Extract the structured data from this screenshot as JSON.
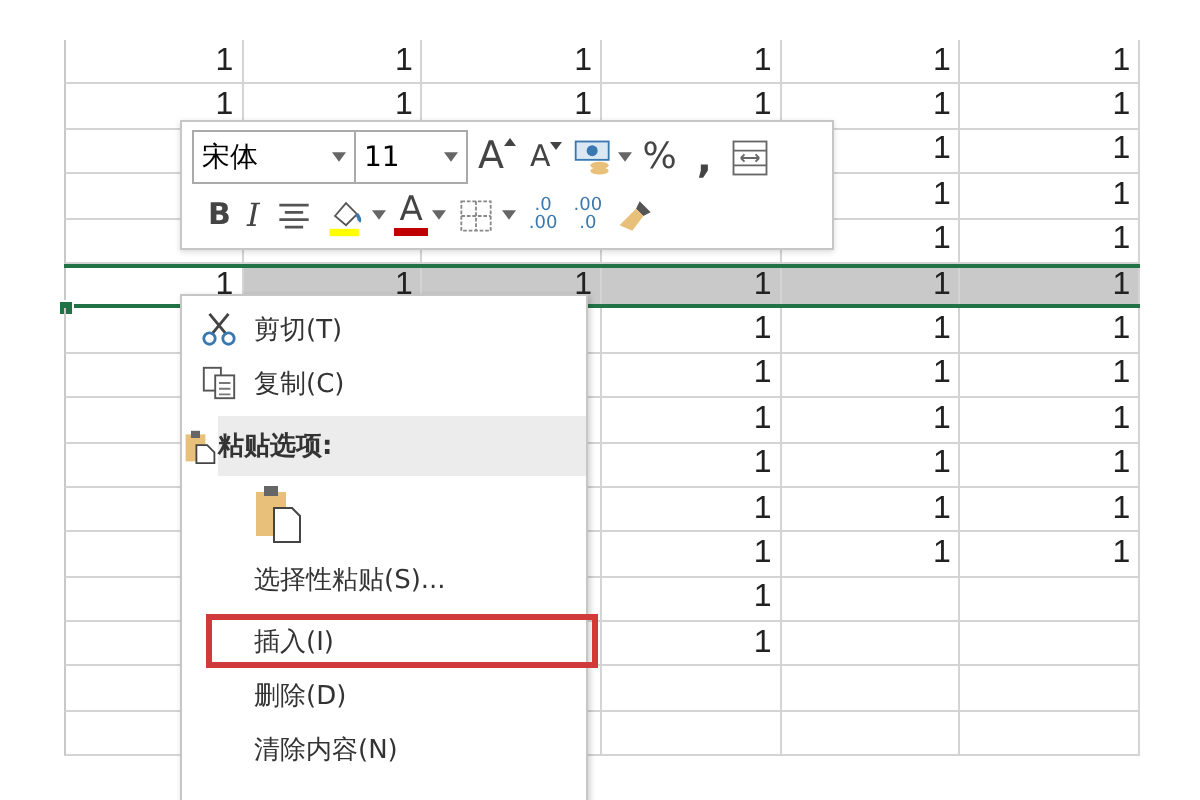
{
  "grid": {
    "rows": [
      {
        "selected": false,
        "cells": [
          "1",
          "1",
          "1",
          "1",
          "1",
          "1"
        ]
      },
      {
        "selected": false,
        "cells": [
          "1",
          "1",
          "1",
          "1",
          "1",
          "1"
        ]
      },
      {
        "selected": false,
        "cells": [
          null,
          null,
          null,
          null,
          "1",
          "1"
        ]
      },
      {
        "selected": false,
        "cells": [
          null,
          null,
          null,
          null,
          "1",
          "1"
        ]
      },
      {
        "selected": false,
        "cells": [
          null,
          null,
          null,
          null,
          "1",
          "1"
        ]
      },
      {
        "selected": true,
        "cells": [
          "1",
          "1",
          "1",
          "1",
          "1",
          "1"
        ]
      },
      {
        "selected": false,
        "cells": [
          null,
          null,
          null,
          "1",
          "1",
          "1"
        ]
      },
      {
        "selected": false,
        "cells": [
          null,
          null,
          null,
          "1",
          "1",
          "1"
        ]
      },
      {
        "selected": false,
        "cells": [
          null,
          null,
          null,
          "1",
          "1",
          "1"
        ]
      },
      {
        "selected": false,
        "cells": [
          null,
          null,
          null,
          "1",
          "1",
          "1"
        ]
      },
      {
        "selected": false,
        "cells": [
          null,
          null,
          null,
          "1",
          "1",
          "1"
        ]
      },
      {
        "selected": false,
        "cells": [
          null,
          null,
          null,
          "1",
          "1",
          "1"
        ]
      },
      {
        "selected": false,
        "cells": [
          null,
          null,
          null,
          "1",
          null,
          null
        ]
      },
      {
        "selected": false,
        "cells": [
          null,
          null,
          null,
          "1",
          null,
          null
        ]
      },
      {
        "selected": false,
        "cells": [
          null,
          null,
          null,
          null,
          null,
          null
        ]
      },
      {
        "selected": false,
        "cells": [
          null,
          null,
          null,
          null,
          null,
          null
        ]
      }
    ]
  },
  "toolbar": {
    "font": "宋体",
    "size": "11",
    "row1": [
      {
        "kind": "grow",
        "text": "A"
      },
      {
        "kind": "shrink",
        "text": "A"
      },
      {
        "kind": "accounting"
      },
      {
        "kind": "caret"
      },
      {
        "kind": "percent",
        "text": "%"
      },
      {
        "kind": "comma",
        "text": ","
      },
      {
        "kind": "format"
      }
    ],
    "row2": [
      {
        "kind": "bold",
        "text": "B"
      },
      {
        "kind": "italic",
        "text": "I"
      },
      {
        "kind": "center"
      },
      {
        "kind": "fill",
        "color": "#ffff00"
      },
      {
        "kind": "caret"
      },
      {
        "kind": "fontcolor",
        "text": "A",
        "color": "#c00000"
      },
      {
        "kind": "caret"
      },
      {
        "kind": "borders"
      },
      {
        "kind": "caret"
      },
      {
        "kind": "incdec",
        "top": ".0",
        "bottom": ".00"
      },
      {
        "kind": "decdec",
        "top": ".00",
        "bottom": ".0"
      },
      {
        "kind": "painter"
      }
    ]
  },
  "menu": {
    "items": [
      {
        "kind": "cut",
        "label": "剪切(T)",
        "highlighted": false
      },
      {
        "kind": "copy",
        "label": "复制(C)",
        "highlighted": false
      },
      {
        "kind": "header",
        "label": "粘贴选项:",
        "highlighted": false
      },
      {
        "kind": "paste-option",
        "highlighted": false
      },
      {
        "kind": "plain",
        "label": "选择性粘贴(S)...",
        "highlighted": false
      },
      {
        "kind": "plain",
        "label": "插入(I)",
        "highlighted": true
      },
      {
        "kind": "plain",
        "label": "删除(D)",
        "highlighted": false
      },
      {
        "kind": "plain",
        "label": "清除内容(N)",
        "highlighted": false
      }
    ]
  }
}
